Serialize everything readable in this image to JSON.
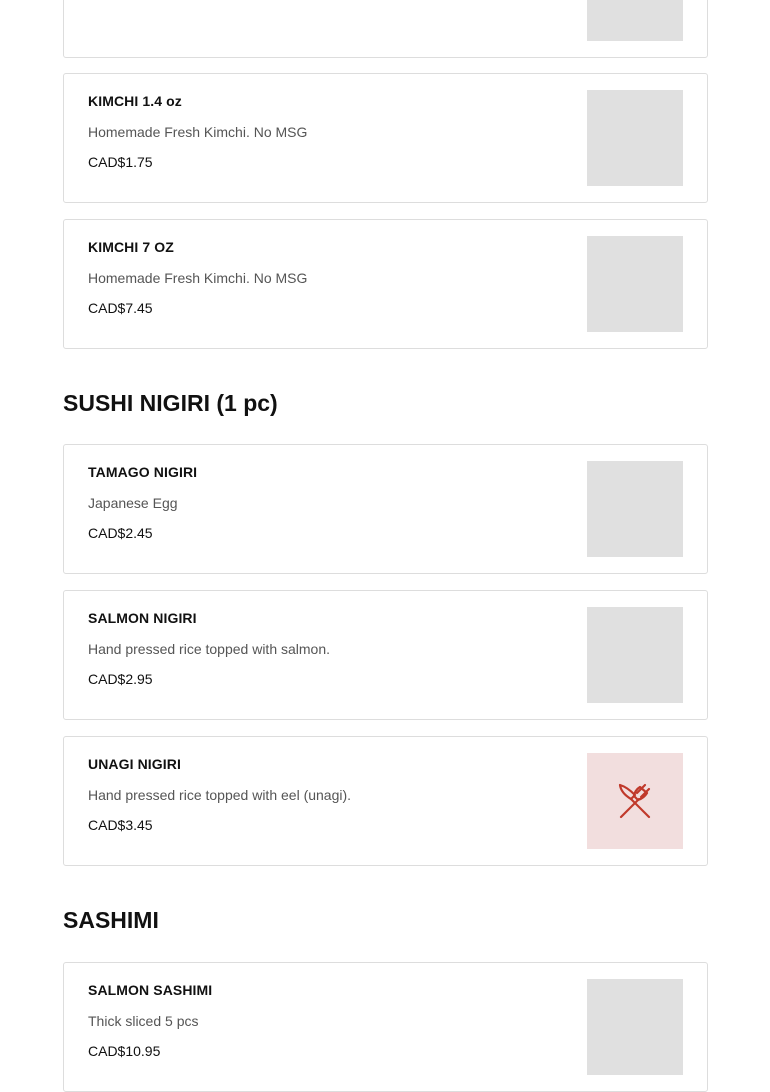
{
  "sections": [
    {
      "title": "",
      "items": [
        {
          "name": "",
          "description": "",
          "price": ""
        },
        {
          "name": "KIMCHI 1.4 oz",
          "description": "Homemade Fresh Kimchi. No MSG",
          "price": "CAD$1.75"
        },
        {
          "name": "KIMCHI 7 OZ",
          "description": "Homemade Fresh Kimchi. No MSG",
          "price": "CAD$7.45"
        }
      ]
    },
    {
      "title": "SUSHI NIGIRI (1 pc)",
      "items": [
        {
          "name": "TAMAGO NIGIRI",
          "description": "Japanese Egg",
          "price": "CAD$2.45"
        },
        {
          "name": "SALMON NIGIRI",
          "description": "Hand pressed rice topped with salmon.",
          "price": "CAD$2.95"
        },
        {
          "name": "UNAGI NIGIRI",
          "description": "Hand pressed rice topped with eel (unagi).",
          "price": "CAD$3.45",
          "icon": "utensils-icon"
        }
      ]
    },
    {
      "title": "SASHIMI",
      "items": [
        {
          "name": "SALMON SASHIMI",
          "description": "Thick sliced 5 pcs",
          "price": "CAD$10.95"
        }
      ]
    }
  ],
  "colors": {
    "thumb_gray": "#e0e0e0",
    "thumb_placeholder": "#f2dede",
    "placeholder_icon": "#c0392b",
    "border": "#dddddd"
  }
}
